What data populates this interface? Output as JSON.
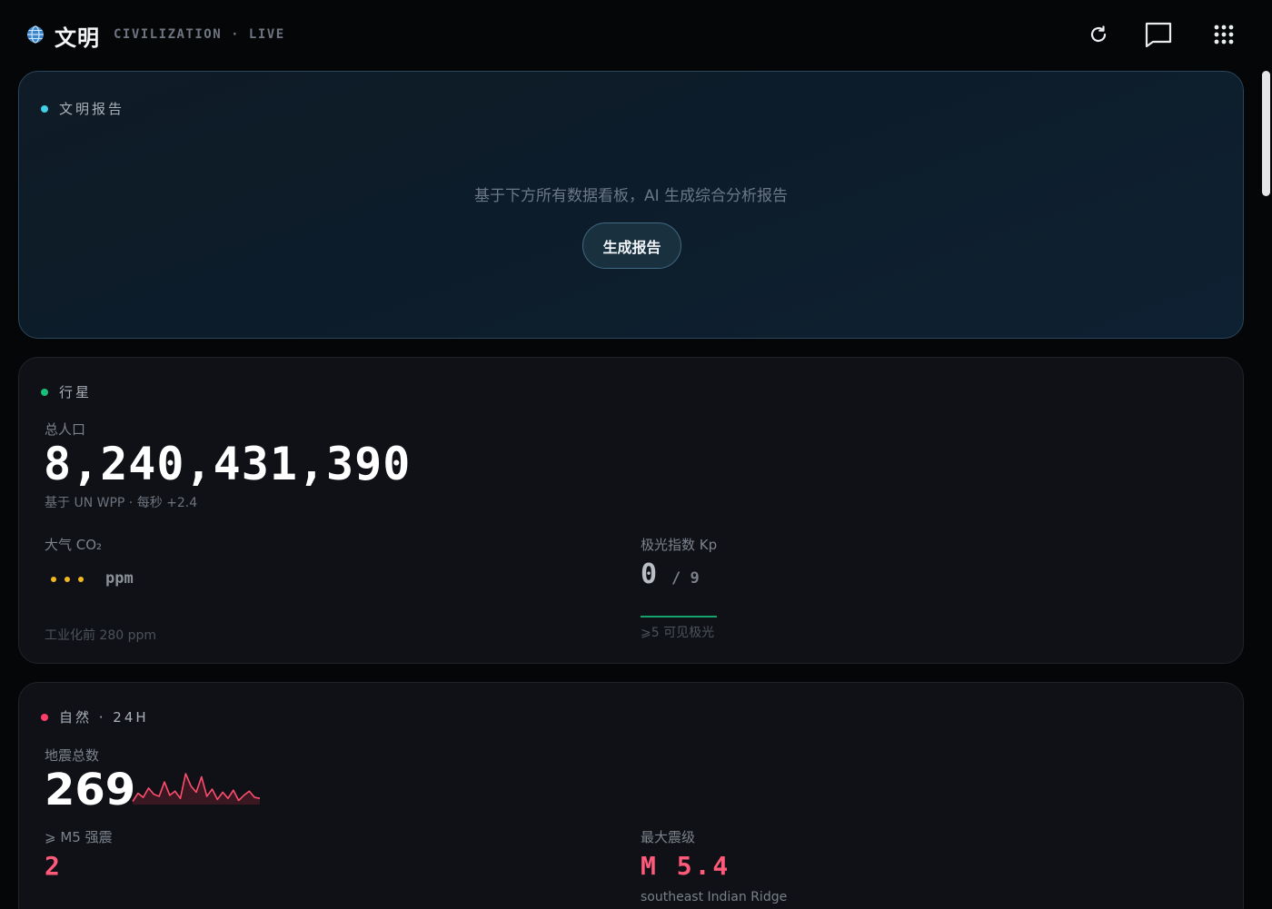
{
  "header": {
    "title": "文明",
    "subtitle": "CIVILIZATION · LIVE",
    "icons": [
      "globe-icon",
      "refresh-icon",
      "chat-icon",
      "grid-menu-icon"
    ]
  },
  "report": {
    "section_title": "文明报告",
    "hint": "基于下方所有数据看板，AI 生成综合分析报告",
    "button_label": "生成报告",
    "dot_color": "#3fd0e6"
  },
  "planet": {
    "section_title": "行星",
    "dot_color": "#17c07a",
    "population_label": "总人口",
    "population_value": "8,240,431,390",
    "population_note": "基于 UN WPP · 每秒 +2.4",
    "co2_label": "大气 CO₂",
    "co2_unit": "ppm",
    "co2_note": "工业化前 280 ppm",
    "kp_label": "极光指数 Kp",
    "kp_value": "0",
    "kp_max": "/ 9",
    "kp_note": "⩾5 可见极光"
  },
  "nature": {
    "section_title": "自然 · 24H",
    "dot_color": "#ff3d6a",
    "quake_label": "地震总数",
    "quake_count": "269",
    "m5_label": "⩾ M5 强震",
    "m5_value": "2",
    "max_label": "最大震级",
    "max_value": "M 5.4",
    "max_place": "southeast Indian Ridge",
    "sparkline": [
      3,
      11,
      7,
      16,
      10,
      8,
      22,
      9,
      13,
      6,
      30,
      18,
      12,
      27,
      8,
      15,
      5,
      12,
      6,
      14,
      4,
      9,
      13,
      7,
      6
    ]
  }
}
